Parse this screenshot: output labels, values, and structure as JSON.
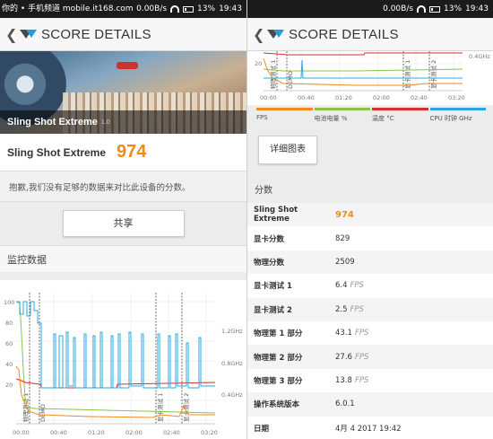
{
  "left": {
    "status": {
      "left_text": "0.00B/s",
      "battery": "13%",
      "time": "19:43"
    },
    "watermark": "你的 • 手机频道 mobile.it168.com",
    "header": {
      "title": "SCORE DETAILS"
    },
    "hero": {
      "caption": "Sling Shot Extreme",
      "version": "1.0"
    },
    "score": {
      "name": "Sling Shot Extreme",
      "value": "974"
    },
    "note": "抱歉,我们没有足够的数据来对比此设备的分数。",
    "share_label": "共享",
    "monitor_title": "监控数据",
    "chart": {
      "y_ticks": [
        "100",
        "80",
        "60",
        "40",
        "20"
      ],
      "right_ticks": [
        "1.2GHz",
        "0.8GHz",
        "0.4GHz"
      ],
      "x_ticks": [
        "00:00",
        "00:40",
        "01:20",
        "02:00",
        "02:40",
        "03:20"
      ],
      "markers": [
        "物理测试 1",
        "DEMO",
        "显卡测试 1",
        "显卡测试 2"
      ]
    }
  },
  "right": {
    "status": {
      "speed": "0.00B/s",
      "battery": "13%",
      "time": "19:43"
    },
    "header": {
      "title": "SCORE DETAILS"
    },
    "chart": {
      "y_ticks": [
        "20"
      ],
      "right_ticks": [
        "0.4GHz"
      ],
      "x_ticks": [
        "00:00",
        "00:40",
        "01:20",
        "02:00",
        "02:40",
        "03:20"
      ],
      "markers": [
        "物理测试 1",
        "DEMO",
        "显卡测试 1",
        "显卡测试 2"
      ]
    },
    "legend": [
      {
        "label": "FPS",
        "color": "#f28a1a"
      },
      {
        "label": "电池电量 %",
        "color": "#8bc34a"
      },
      {
        "label": "温度 °C",
        "color": "#d32f2f"
      },
      {
        "label": "CPU 时钟 GHz",
        "color": "#29a8e0"
      }
    ],
    "detail_button": "详细图表",
    "scores_title": "分数",
    "rows": [
      {
        "key": "Sling Shot Extreme",
        "value": "974",
        "unit": ""
      },
      {
        "key": "显卡分数",
        "value": "829",
        "unit": ""
      },
      {
        "key": "物理分数",
        "value": "2509",
        "unit": ""
      },
      {
        "key": "显卡测试 1",
        "value": "6.4",
        "unit": "FPS"
      },
      {
        "key": "显卡测试 2",
        "value": "2.5",
        "unit": "FPS"
      },
      {
        "key": "物理第 1 部分",
        "value": "43.1",
        "unit": "FPS"
      },
      {
        "key": "物理第 2 部分",
        "value": "27.6",
        "unit": "FPS"
      },
      {
        "key": "物理第 3 部分",
        "value": "13.8",
        "unit": "FPS"
      },
      {
        "key": "操作系统版本",
        "value": "6.0.1",
        "unit": ""
      },
      {
        "key": "日期",
        "value": "4月 4 2017 19:42",
        "unit": ""
      }
    ]
  },
  "colors": {
    "accent": "#f28a1a",
    "cpu": "#29a8e0",
    "temp": "#d32f2f",
    "battery": "#8bc34a"
  }
}
